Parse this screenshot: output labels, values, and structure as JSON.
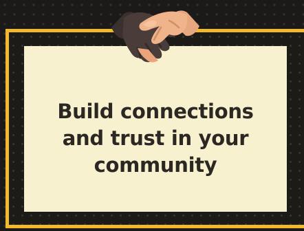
{
  "headline": {
    "line1": "Build connections",
    "line2": "and trust in your",
    "line3": "community"
  },
  "colors": {
    "background": "#1b1a18",
    "frame": "#f2b92a",
    "card": "#f8f1cf",
    "text": "#2b2824"
  },
  "icon": "handshake-icon"
}
